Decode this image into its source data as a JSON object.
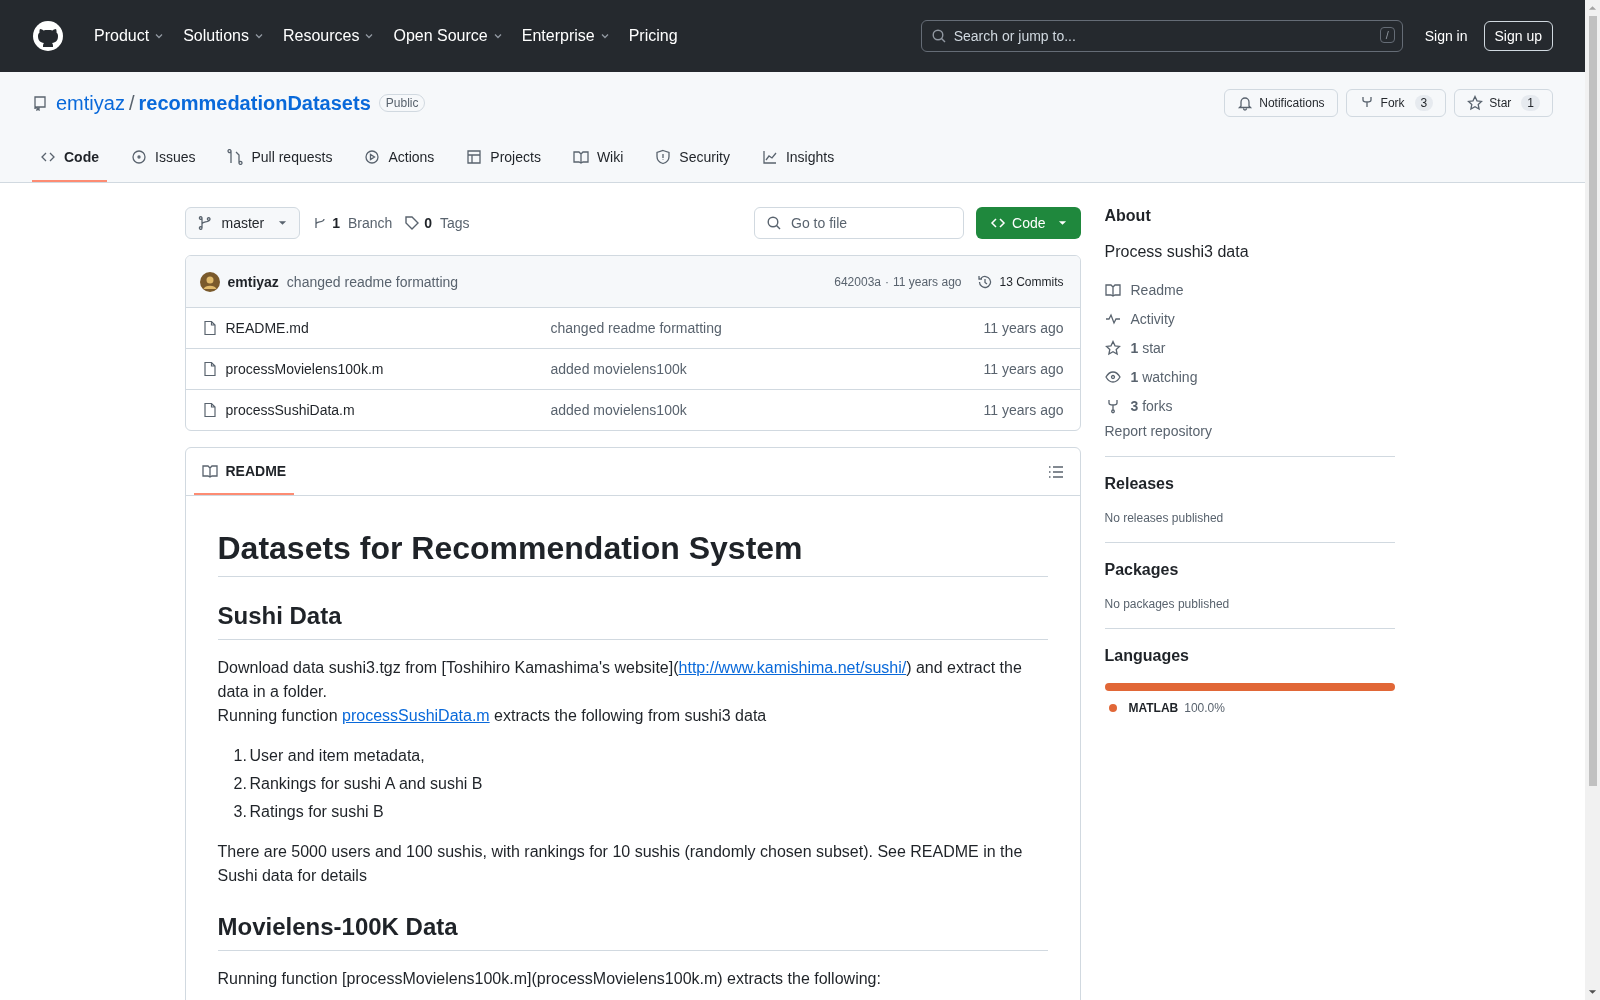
{
  "header": {
    "nav": [
      {
        "label": "Product",
        "has_menu": true
      },
      {
        "label": "Solutions",
        "has_menu": true
      },
      {
        "label": "Resources",
        "has_menu": true
      },
      {
        "label": "Open Source",
        "has_menu": true
      },
      {
        "label": "Enterprise",
        "has_menu": true
      },
      {
        "label": "Pricing",
        "has_menu": false
      }
    ],
    "search": {
      "placeholder": "Search or jump to...",
      "shortcut": "/"
    },
    "sign_in": "Sign in",
    "sign_up": "Sign up"
  },
  "repo": {
    "owner": "emtiyaz",
    "separator": "/",
    "name": "recommedationDatasets",
    "visibility": "Public",
    "actions": [
      {
        "label": "Notifications"
      },
      {
        "label": "Fork",
        "count": "3"
      },
      {
        "label": "Star",
        "count": "1"
      }
    ],
    "tabs": [
      {
        "label": "Code",
        "selected": true
      },
      {
        "label": "Issues",
        "selected": false
      },
      {
        "label": "Pull requests",
        "selected": false
      },
      {
        "label": "Actions",
        "selected": false
      },
      {
        "label": "Projects",
        "selected": false
      },
      {
        "label": "Wiki",
        "selected": false
      },
      {
        "label": "Security",
        "selected": false
      },
      {
        "label": "Insights",
        "selected": false
      }
    ]
  },
  "toolbar": {
    "branch": "master",
    "branches": {
      "count": "1",
      "label": "Branch"
    },
    "tags": {
      "count": "0",
      "label": "Tags"
    },
    "go_to_file": {
      "placeholder": "Go to file"
    },
    "code_button": "Code"
  },
  "commit": {
    "author": "emtiyaz",
    "message": "changed readme formatting",
    "hash": "642003a",
    "separator": "·",
    "time": "11 years ago",
    "commits": "13 Commits"
  },
  "files": [
    {
      "name": "README.md",
      "message": "changed readme formatting",
      "time": "11 years ago"
    },
    {
      "name": "processMovielens100k.m",
      "message": "added movielens100k",
      "time": "11 years ago"
    },
    {
      "name": "processSushiData.m",
      "message": "added movielens100k",
      "time": "11 years ago"
    }
  ],
  "readme": {
    "tab": "README",
    "blocks": [
      {
        "kind": "h1",
        "text": "Datasets for Recommendation System"
      },
      {
        "kind": "h2",
        "text": "Sushi Data"
      },
      {
        "kind": "p",
        "lines": [
          [
            {
              "kind": "text",
              "text": "Download data sushi3.tgz from [Toshihiro Kamashima's website]("
            },
            {
              "kind": "link",
              "text": "http://www.kamishima.net/sushi/"
            },
            {
              "kind": "text",
              "text": ") and extract the data in a folder."
            }
          ],
          [
            {
              "kind": "text",
              "text": "Running function "
            },
            {
              "kind": "link",
              "text": "processSushiData.m"
            },
            {
              "kind": "text",
              "text": " extracts the following from sushi3 data"
            }
          ]
        ]
      },
      {
        "kind": "ol",
        "items": [
          {
            "number": "1.",
            "text": "User and item metadata,"
          },
          {
            "number": "2.",
            "text": "Rankings for sushi A and sushi B"
          },
          {
            "number": "3.",
            "text": "Ratings for sushi B"
          }
        ]
      },
      {
        "kind": "p",
        "lines": [
          [
            {
              "kind": "text",
              "text": "There are 5000 users and 100 sushis, with rankings for 10 sushis (randomly chosen subset). See README in the Sushi data for details"
            }
          ]
        ]
      },
      {
        "kind": "h2",
        "text": "Movielens-100K Data"
      },
      {
        "kind": "p",
        "lines": [
          [
            {
              "kind": "text",
              "text": "Running function [processMovielens100k.m](processMovielens100k.m) extracts the following:"
            }
          ]
        ]
      }
    ]
  },
  "sidebar": {
    "about": {
      "title": "About",
      "description": "Process sushi3 data",
      "links": [
        {
          "label": "Readme"
        },
        {
          "label": "Activity"
        },
        {
          "count": "1",
          "label": "star"
        },
        {
          "count": "1",
          "label": "watching"
        },
        {
          "count": "3",
          "label": "forks"
        }
      ],
      "report": "Report repository"
    },
    "releases": {
      "title": "Releases",
      "note": "No releases published"
    },
    "packages": {
      "title": "Packages",
      "note": "No packages published"
    },
    "languages": {
      "title": "Languages",
      "items": [
        {
          "name": "MATLAB",
          "percent": "100.0%",
          "level": 1.0,
          "color": "#e16737"
        }
      ]
    }
  }
}
